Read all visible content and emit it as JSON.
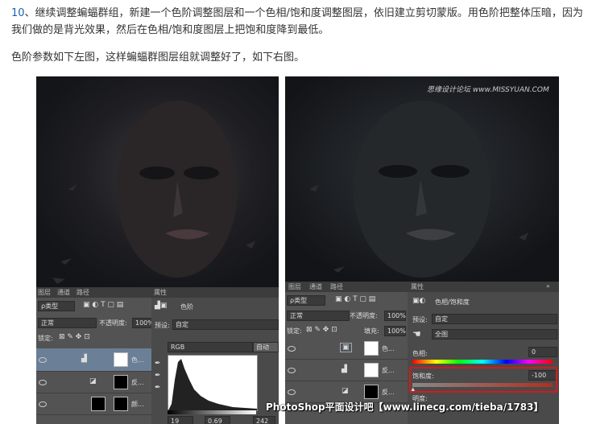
{
  "article": {
    "step_number": "10",
    "paragraph1": "、继续调整蝙蝠群组，新建一个色阶调整图层和一个色相/饱和度调整图层，依旧建立剪切蒙版。用色阶把整体压暗，因为我们做的是背光效果，然后在色相/饱和度图层上把饱和度降到最低。",
    "paragraph2": "色阶参数如下左图，这样蝙蝠群图层组就调整好了，如下右图。"
  },
  "left_screenshot": {
    "layers_tabs": [
      "图层",
      "通道",
      "路径"
    ],
    "kind_label": "ρ类型",
    "blend_mode": "正常",
    "opacity_label": "不透明度:",
    "opacity_value": "100%",
    "lock_label": "锁定:",
    "layers": [
      {
        "name": "色..."
      },
      {
        "name": "反..."
      },
      {
        "name": "颜..."
      }
    ],
    "properties": {
      "tab": "属性",
      "title": "色阶",
      "preset_label": "预设:",
      "preset_value": "自定",
      "channel": "RGB",
      "auto_button": "自动",
      "input_values": [
        "19",
        "0.69",
        "242"
      ]
    }
  },
  "right_screenshot": {
    "watermark": "思缘设计论坛 www.MISSYUAN.COM",
    "layers_tabs": [
      "图层",
      "通道",
      "路径"
    ],
    "kind_label": "ρ类型",
    "blend_mode": "正常",
    "opacity_label": "不透明度:",
    "opacity_value": "100%",
    "lock_label": "锁定:",
    "fill_label": "填充:",
    "fill_value": "100%",
    "layers": [
      {
        "name": "色..."
      },
      {
        "name": "反..."
      },
      {
        "name": "反..."
      }
    ],
    "properties": {
      "tab": "属性",
      "title": "色相/饱和度",
      "preset_label": "预设:",
      "preset_value": "自定",
      "range_value": "全图",
      "hue_label": "色相:",
      "hue_value": "0",
      "saturation_label": "饱和度:",
      "saturation_value": "-100",
      "lightness_label": "明度:"
    }
  },
  "footer_watermark": "PhotoShop平面设计吧【www.linecg.com/tieba/1783】",
  "colors": {
    "panel_bg": "#535353",
    "selected_row": "#6b7f96",
    "highlight_box": "#d51a1a",
    "step_number": "#1a5fb4"
  }
}
